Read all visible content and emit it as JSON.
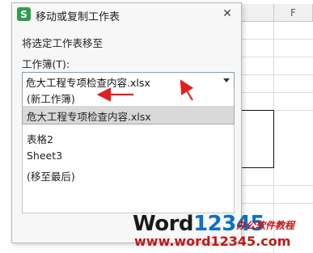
{
  "background": {
    "column_letter": "F"
  },
  "dialog": {
    "icon_letter": "S",
    "title": "移动或复制工作表",
    "close_label": "✕",
    "move_to_label": "将选定工作表移至",
    "workbook_label": "工作簿(T):",
    "workbook_selected": "危大工程专项检查内容.xlsx",
    "workbook_options": [
      "(新工作簿)",
      "危大工程专项检查内容.xlsx"
    ],
    "sheets": [
      "表格2",
      "Sheet3",
      "(移至最后)"
    ]
  },
  "watermark": {
    "logo_word": "Word",
    "logo_num": "12345",
    "tagline": "办公软件教程",
    "url": "www.word12345.com"
  },
  "colors": {
    "accent_arrow": "#e02020",
    "selected_bg": "#d9d9d9",
    "brand_green": "#2e9e4e"
  }
}
